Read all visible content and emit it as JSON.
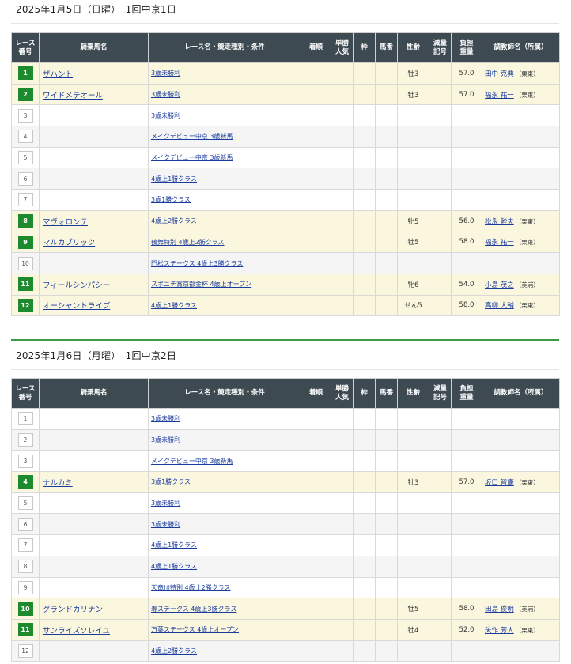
{
  "columns": [
    "レース番号",
    "騎乗馬名",
    "レース名・競走種別・条件",
    "着順",
    "単勝人気",
    "枠",
    "馬番",
    "性齢",
    "減量記号",
    "負担重量",
    "調教師名（所属）"
  ],
  "days": [
    {
      "title": "2025年1月5日（日曜）　1回中京1日",
      "races": [
        {
          "num": "1",
          "win": true,
          "horse": "ザハント",
          "race": "3歳未勝利",
          "sexage": "牡3",
          "weight": "57.0",
          "trainer": "田中 克典",
          "base": "（栗東）"
        },
        {
          "num": "2",
          "win": true,
          "horse": "ワイドメテオール",
          "race": "3歳未勝利",
          "sexage": "牡3",
          "weight": "57.0",
          "trainer": "福永 祐一",
          "base": "（栗東）"
        },
        {
          "num": "3",
          "win": false,
          "horse": "",
          "race": "3歳未勝利",
          "sexage": "",
          "weight": "",
          "trainer": "",
          "base": ""
        },
        {
          "num": "4",
          "win": false,
          "horse": "",
          "race": "メイクデビュー中京 3歳新馬",
          "sexage": "",
          "weight": "",
          "trainer": "",
          "base": ""
        },
        {
          "num": "5",
          "win": false,
          "horse": "",
          "race": "メイクデビュー中京 3歳新馬",
          "sexage": "",
          "weight": "",
          "trainer": "",
          "base": ""
        },
        {
          "num": "6",
          "win": false,
          "horse": "",
          "race": "4歳上1勝クラス",
          "sexage": "",
          "weight": "",
          "trainer": "",
          "base": ""
        },
        {
          "num": "7",
          "win": false,
          "horse": "",
          "race": "3歳1勝クラス",
          "sexage": "",
          "weight": "",
          "trainer": "",
          "base": ""
        },
        {
          "num": "8",
          "win": true,
          "horse": "マヴォロンテ",
          "race": "4歳上2勝クラス",
          "sexage": "牝5",
          "weight": "56.0",
          "trainer": "松永 幹夫",
          "base": "（栗東）"
        },
        {
          "num": "9",
          "win": true,
          "horse": "マルカブリッツ",
          "race": "鶴舞特別 4歳上2勝クラス",
          "sexage": "牡5",
          "weight": "58.0",
          "trainer": "福永 祐一",
          "base": "（栗東）"
        },
        {
          "num": "10",
          "win": false,
          "horse": "",
          "race": "門松ステークス 4歳上3勝クラス",
          "sexage": "",
          "weight": "",
          "trainer": "",
          "base": ""
        },
        {
          "num": "11",
          "win": true,
          "horse": "フィールシンパシー",
          "race": "スポニチ賞京都金杯 4歳上オープン",
          "sexage": "牝6",
          "weight": "54.0",
          "trainer": "小島 茂之",
          "base": "（美浦）"
        },
        {
          "num": "12",
          "win": true,
          "horse": "オーシャントライブ",
          "race": "4歳上1勝クラス",
          "sexage": "せん5",
          "weight": "58.0",
          "trainer": "高柳 大輔",
          "base": "（栗東）"
        }
      ]
    },
    {
      "title": "2025年1月6日（月曜）　1回中京2日",
      "races": [
        {
          "num": "1",
          "win": false,
          "horse": "",
          "race": "3歳未勝利",
          "sexage": "",
          "weight": "",
          "trainer": "",
          "base": ""
        },
        {
          "num": "2",
          "win": false,
          "horse": "",
          "race": "3歳未勝利",
          "sexage": "",
          "weight": "",
          "trainer": "",
          "base": ""
        },
        {
          "num": "3",
          "win": false,
          "horse": "",
          "race": "メイクデビュー中京 3歳新馬",
          "sexage": "",
          "weight": "",
          "trainer": "",
          "base": ""
        },
        {
          "num": "4",
          "win": true,
          "horse": "ナルカミ",
          "race": "3歳1勝クラス",
          "sexage": "牡3",
          "weight": "57.0",
          "trainer": "坂口 智康",
          "base": "（栗東）"
        },
        {
          "num": "5",
          "win": false,
          "horse": "",
          "race": "3歳未勝利",
          "sexage": "",
          "weight": "",
          "trainer": "",
          "base": ""
        },
        {
          "num": "6",
          "win": false,
          "horse": "",
          "race": "3歳未勝利",
          "sexage": "",
          "weight": "",
          "trainer": "",
          "base": ""
        },
        {
          "num": "7",
          "win": false,
          "horse": "",
          "race": "4歳上1勝クラス",
          "sexage": "",
          "weight": "",
          "trainer": "",
          "base": ""
        },
        {
          "num": "8",
          "win": false,
          "horse": "",
          "race": "4歳上1勝クラス",
          "sexage": "",
          "weight": "",
          "trainer": "",
          "base": ""
        },
        {
          "num": "9",
          "win": false,
          "horse": "",
          "race": "天竜川特別 4歳上2勝クラス",
          "sexage": "",
          "weight": "",
          "trainer": "",
          "base": ""
        },
        {
          "num": "10",
          "win": true,
          "horse": "グランドカリナン",
          "race": "寿ステークス 4歳上3勝クラス",
          "sexage": "牡5",
          "weight": "58.0",
          "trainer": "田島 俊明",
          "base": "（美浦）"
        },
        {
          "num": "11",
          "win": true,
          "horse": "サンライズソレイユ",
          "race": "万葉ステークス 4歳上オープン",
          "sexage": "牡4",
          "weight": "52.0",
          "trainer": "矢作 芳人",
          "base": "（栗東）"
        },
        {
          "num": "12",
          "win": false,
          "horse": "",
          "race": "4歳上2勝クラス",
          "sexage": "",
          "weight": "",
          "trainer": "",
          "base": ""
        }
      ]
    }
  ]
}
